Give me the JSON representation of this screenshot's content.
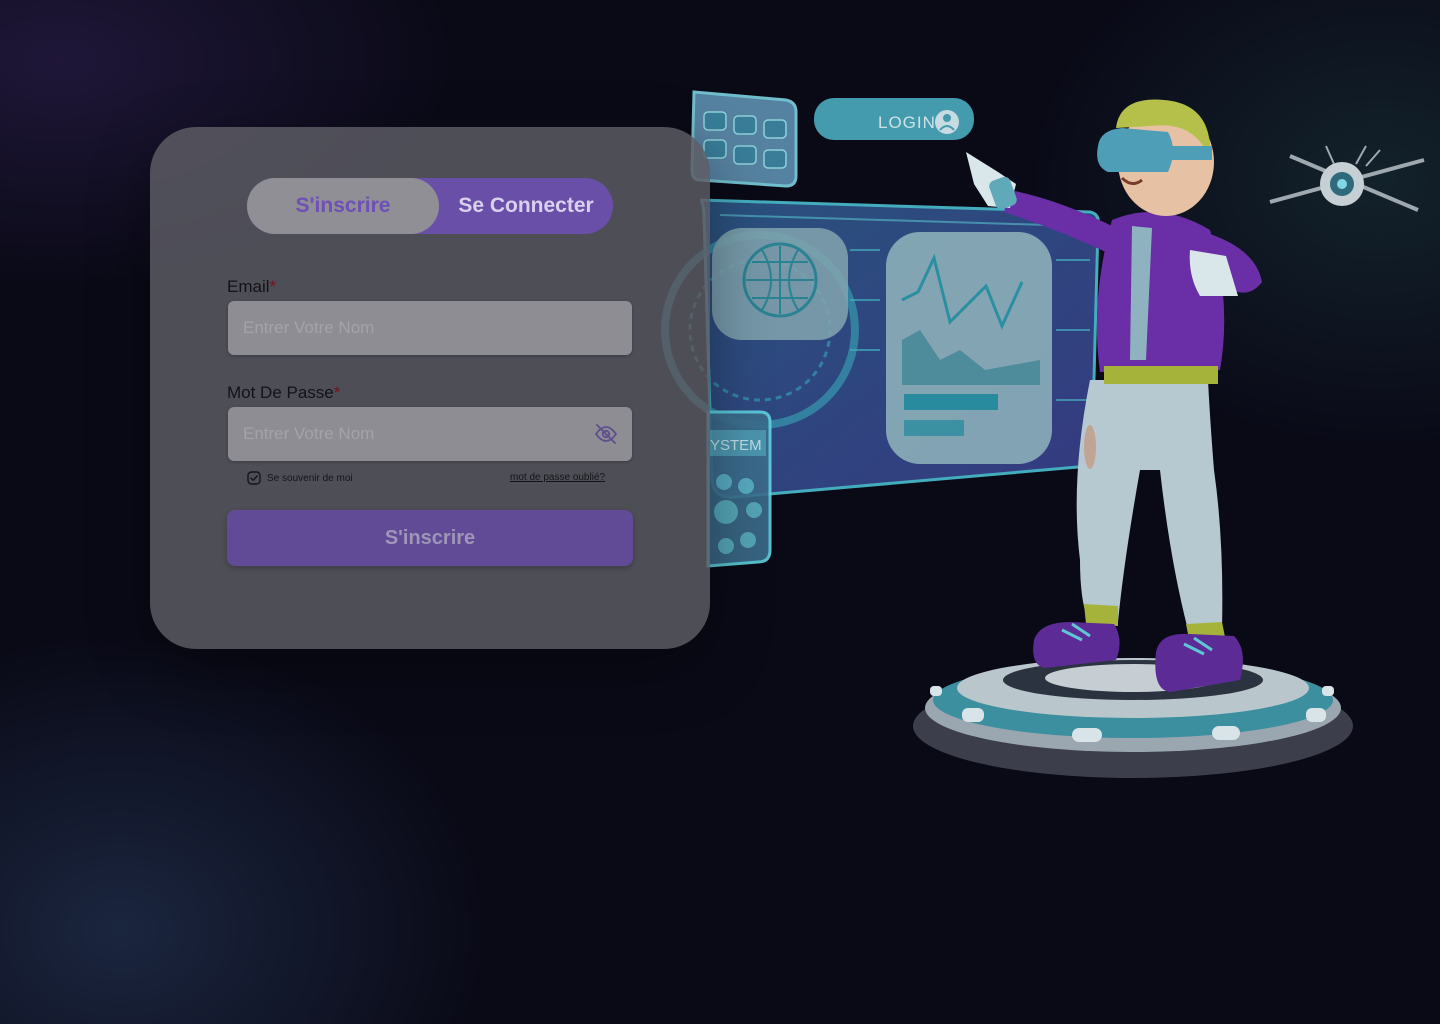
{
  "tabs": {
    "signup_label": "S'inscrire",
    "login_label": "Se Connecter"
  },
  "form": {
    "email_label": "Email",
    "email_placeholder": "Entrer Votre Nom",
    "password_label": "Mot De Passe",
    "password_placeholder": "Entrer Votre Nom",
    "required_mark": "*",
    "remember_label": "Se souvenir de moi",
    "remember_checked": true,
    "forgot_label": "mot de passe oublié?",
    "submit_label": "S'inscrire"
  },
  "illustration": {
    "login_badge": "LOGIN",
    "system_label": "YSTEM"
  },
  "colors": {
    "accent": "#6a4fa8",
    "background": "#0a0a17",
    "hologram": "#3fb8c8"
  },
  "icons": {
    "password_toggle": "eye-off-icon",
    "remember_checkbox": "checkbox-checked-icon"
  }
}
